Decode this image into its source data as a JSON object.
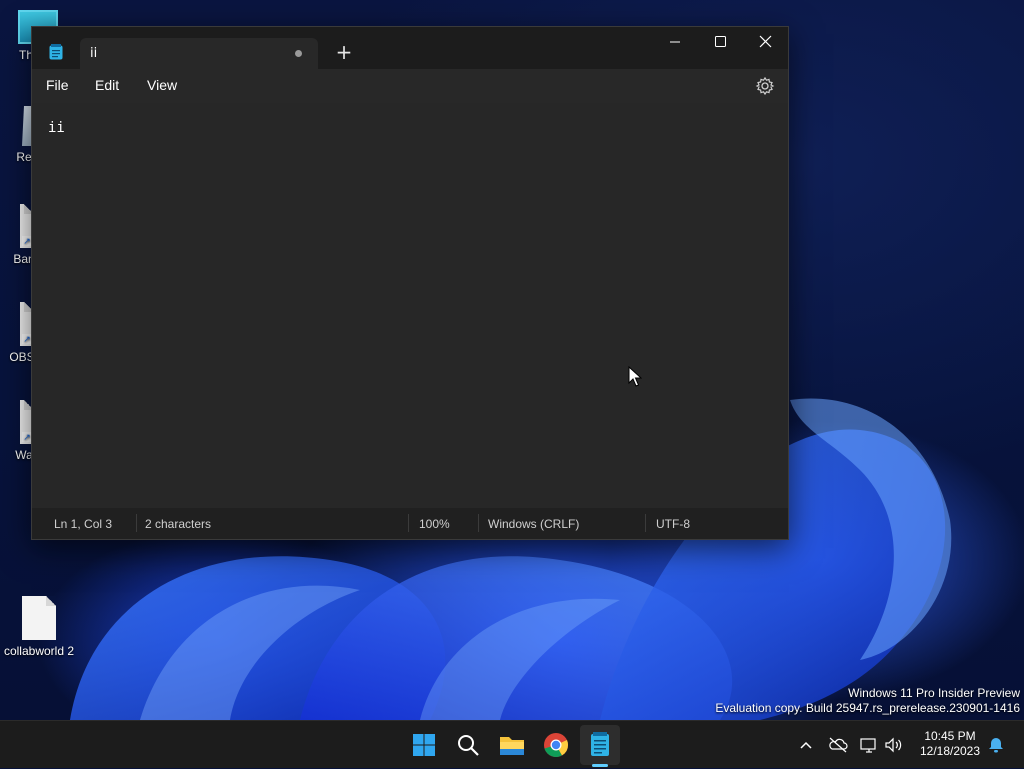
{
  "desktop": {
    "icons": [
      {
        "label": "Th",
        "icon": "this-pc-icon"
      },
      {
        "label": "Recy",
        "icon": "recycle-bin-icon"
      },
      {
        "label": "Ban",
        "icon": "shortcut-icon"
      },
      {
        "label": "OBS",
        "icon": "shortcut-icon"
      },
      {
        "label": "Wa",
        "icon": "shortcut-icon"
      },
      {
        "label": "collabworld 2",
        "icon": "document-icon"
      }
    ],
    "watermark": {
      "line1": "Windows 11 Pro Insider Preview",
      "line2": "Evaluation copy. Build 25947.rs_prerelease.230901-1416"
    }
  },
  "notepad": {
    "tab_title": "ii",
    "new_tab_label": "+",
    "menu": {
      "file": "File",
      "edit": "Edit",
      "view": "View"
    },
    "content": "ii",
    "status": {
      "position": "Ln 1, Col 3",
      "characters": "2 characters",
      "zoom": "100%",
      "line_ending": "Windows (CRLF)",
      "encoding": "UTF-8"
    }
  },
  "taskbar": {
    "apps": [
      "start-icon",
      "search-icon",
      "file-explorer-icon",
      "chrome-icon",
      "notepad-icon"
    ],
    "clock": {
      "time": "10:45 PM",
      "date": "12/18/2023"
    }
  },
  "colors": {
    "accent": "#60cdff",
    "window_bg": "#202020",
    "editor_bg": "#272727"
  }
}
